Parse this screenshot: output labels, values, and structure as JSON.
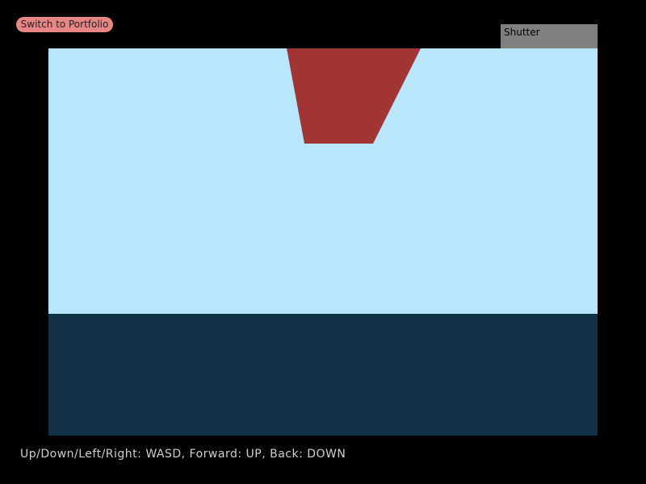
{
  "switch_button": {
    "label": "Switch to Portfolio",
    "color": "#e88686"
  },
  "shutter_button": {
    "label": "Shutter",
    "color": "#808080"
  },
  "scene": {
    "sky_color": "#b8e6fd",
    "ground_color": "#113146",
    "object_color": "#a33434"
  },
  "controls_hint": "Up/Down/Left/Right: WASD, Forward: UP, Back: DOWN"
}
